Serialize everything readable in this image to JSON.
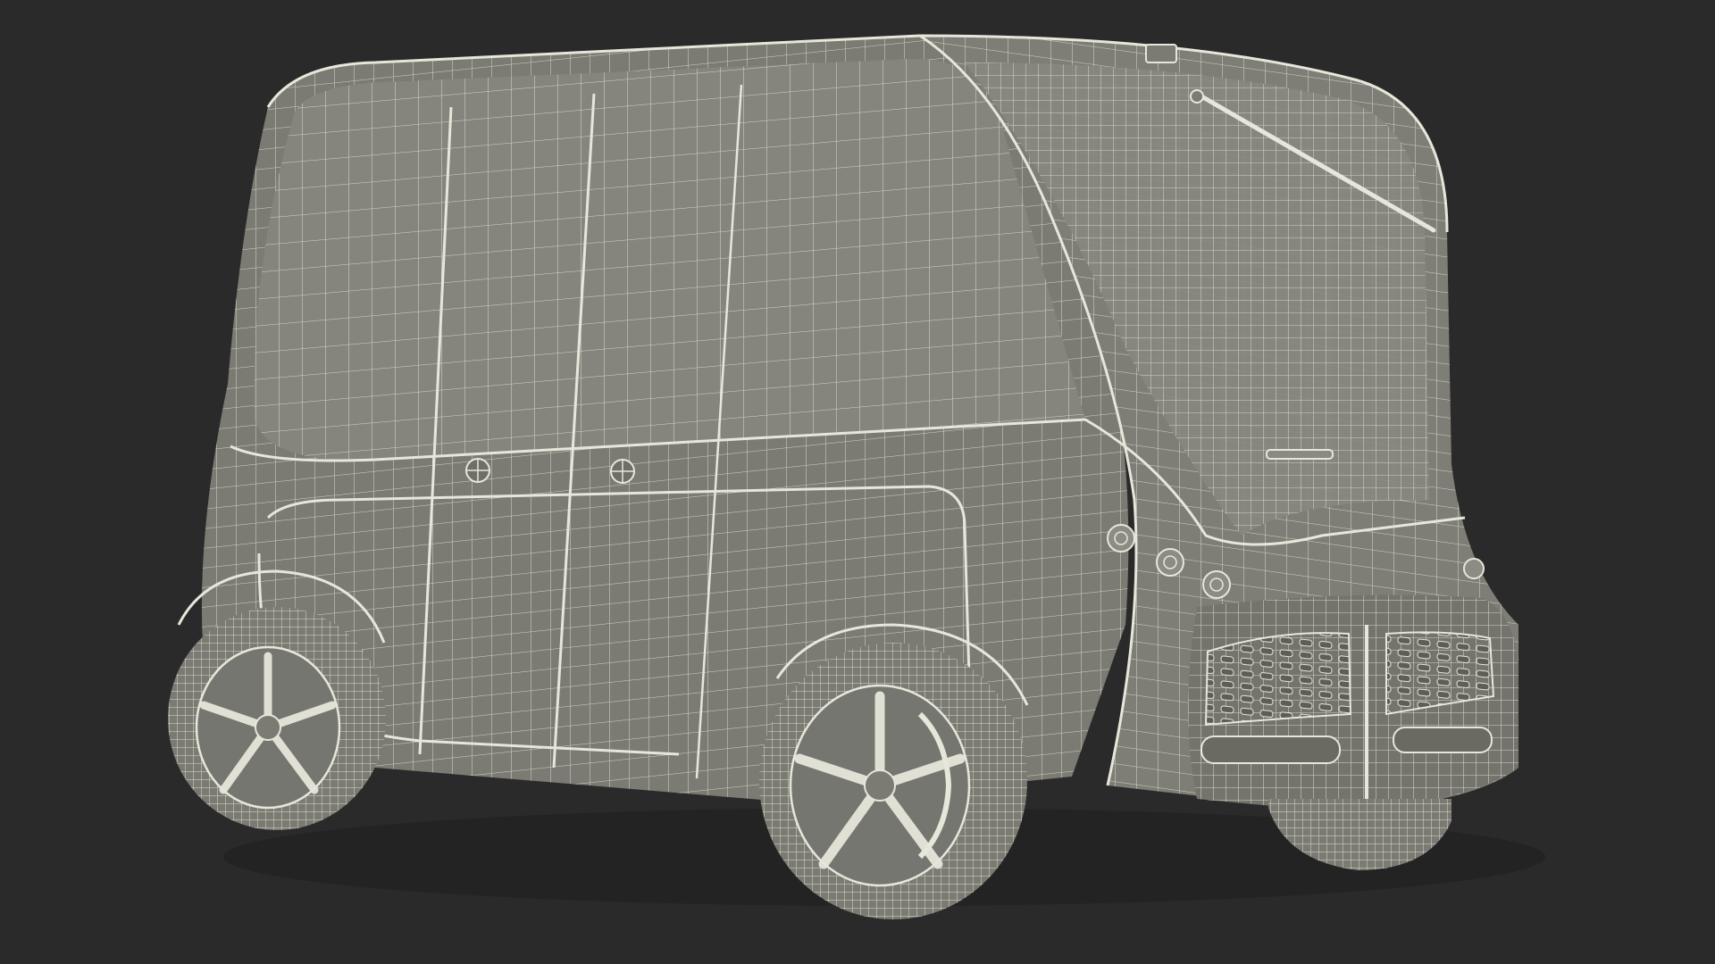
{
  "scene": {
    "subject": "autonomous-shuttle-wireframe",
    "colors": {
      "background": "#2a2a2a",
      "surface": "#7b7b73",
      "surface_light": "#8a8a82",
      "surface_dark": "#66665f",
      "wire": "#e6e6da",
      "wire_faint": "#cfcfc3"
    }
  }
}
